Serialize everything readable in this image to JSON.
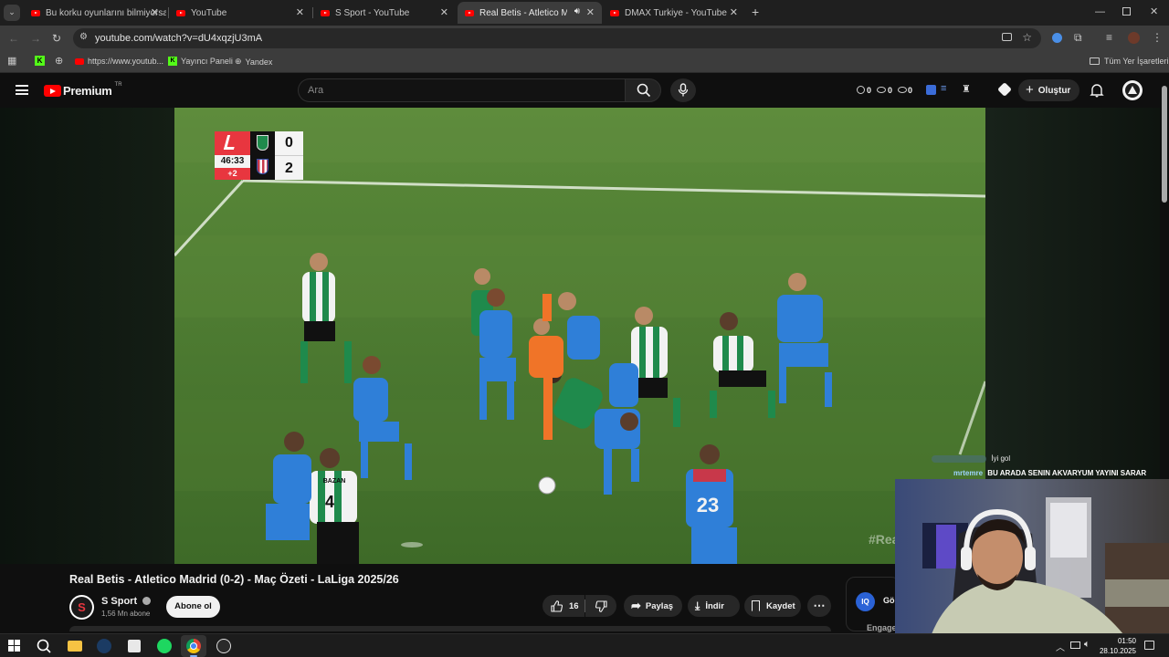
{
  "browser": {
    "tabs": [
      {
        "label": "Bu korku oyunlarını bilmiyorsan",
        "active": false
      },
      {
        "label": "YouTube",
        "active": false
      },
      {
        "label": "S Sport - YouTube",
        "active": false
      },
      {
        "label": "Real Betis - Atletico Madrid",
        "active": true
      },
      {
        "label": "DMAX Turkiye - YouTube",
        "active": false
      }
    ],
    "url": "youtube.com/watch?v=dU4xqzjU3mA",
    "bookmarks": [
      "https://www.youtub...",
      "Yayıncı Paneli",
      "Yandex"
    ],
    "all_bookmarks": "Tüm Yer İşaretleri"
  },
  "youtube": {
    "logo_text": "Premium",
    "region": "TR",
    "search_placeholder": "Ara",
    "stats": [
      "0",
      "0",
      "0"
    ],
    "create_label": "Oluştur"
  },
  "scoreboard": {
    "time": "46:33",
    "added": "+2",
    "home_score": "0",
    "away_score": "2"
  },
  "jerseys": {
    "betis_player": "4",
    "betis_name": "BAZAN",
    "atleti_player": "23"
  },
  "watermark": "#Rea",
  "video": {
    "title": "Real Betis - Atletico Madrid (0-2) - Maç Özeti - LaLiga 2025/26",
    "channel": "S Sport",
    "subscribers": "1,56 Mn abone",
    "subscribe_label": "Abone ol",
    "likes": "16",
    "share_label": "Paylaş",
    "download_label": "İndir",
    "save_label": "Kaydet",
    "side_label_1": "Gö",
    "side_label_2": "Engage"
  },
  "chat": {
    "line1_text": "İyi gol",
    "line2_user": "mrtemre",
    "line2_text": "BU ARADA SENIN AKVARYUM YAYINI SARAR"
  },
  "taskbar": {
    "time": "01:50",
    "date": "28.10.2025"
  },
  "colors": {
    "yt_red": "#ff0000",
    "pitch": "#4f7a32",
    "betis_green": "#1f8a4c",
    "atleti_blue": "#2f7fd8"
  }
}
